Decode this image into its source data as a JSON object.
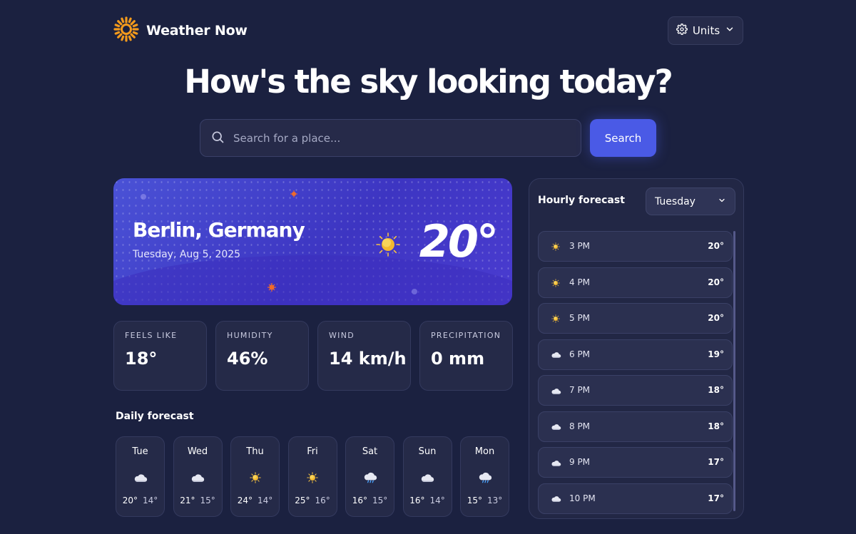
{
  "header": {
    "brand_name": "Weather Now",
    "brand_icon": "sun-logo-icon",
    "units_label": "Units",
    "accent_color": "#f39a1c"
  },
  "hero": {
    "title": "How's the sky looking today?"
  },
  "search": {
    "placeholder": "Search for a place...",
    "value": "",
    "button_label": "Search"
  },
  "current": {
    "city": "Berlin, Germany",
    "date": "Tuesday, Aug 5, 2025",
    "temperature": "20°",
    "icon": "sun-icon"
  },
  "stats": [
    {
      "label": "FEELS LIKE",
      "value": "18°"
    },
    {
      "label": "HUMIDITY",
      "value": "46%"
    },
    {
      "label": "WIND",
      "value": "14 km/h"
    },
    {
      "label": "PRECIPITATION",
      "value": "0 mm"
    }
  ],
  "daily": {
    "title": "Daily forecast",
    "days": [
      {
        "day": "Tue",
        "icon": "cloud-icon",
        "high": "20°",
        "low": "14°"
      },
      {
        "day": "Wed",
        "icon": "cloud-icon",
        "high": "21°",
        "low": "15°"
      },
      {
        "day": "Thu",
        "icon": "sun-icon",
        "high": "24°",
        "low": "14°"
      },
      {
        "day": "Fri",
        "icon": "sun-icon",
        "high": "25°",
        "low": "16°"
      },
      {
        "day": "Sat",
        "icon": "rain-cloud-icon",
        "high": "16°",
        "low": "15°"
      },
      {
        "day": "Sun",
        "icon": "cloud-icon",
        "high": "16°",
        "low": "14°"
      },
      {
        "day": "Mon",
        "icon": "rain-cloud-icon",
        "high": "15°",
        "low": "13°"
      }
    ]
  },
  "hourly": {
    "title": "Hourly forecast",
    "selected_day": "Tuesday",
    "hours": [
      {
        "time": "3 PM",
        "icon": "sun-icon",
        "temp": "20°"
      },
      {
        "time": "4 PM",
        "icon": "sun-icon",
        "temp": "20°"
      },
      {
        "time": "5 PM",
        "icon": "sun-icon",
        "temp": "20°"
      },
      {
        "time": "6 PM",
        "icon": "cloud-icon",
        "temp": "19°"
      },
      {
        "time": "7 PM",
        "icon": "cloud-icon",
        "temp": "18°"
      },
      {
        "time": "8 PM",
        "icon": "cloud-icon",
        "temp": "18°"
      },
      {
        "time": "9 PM",
        "icon": "cloud-icon",
        "temp": "17°"
      },
      {
        "time": "10 PM",
        "icon": "cloud-icon",
        "temp": "17°"
      }
    ]
  }
}
